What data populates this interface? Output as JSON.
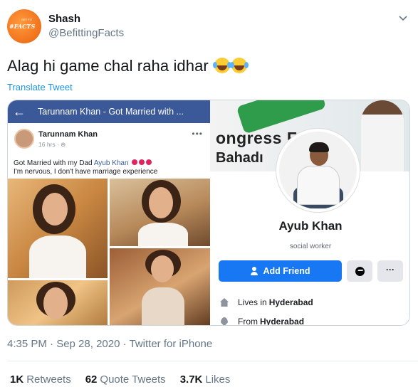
{
  "author": {
    "name": "Shash",
    "handle": "@BefittingFacts",
    "avatar_text": "#FACTS",
    "avatar_subtext": "GET FIT"
  },
  "tweet": {
    "text": "Alag hi game chal raha idhar",
    "emojis": [
      "face-with-tears-of-joy",
      "face-with-tears-of-joy"
    ],
    "translate_label": "Translate Tweet",
    "timestamp": "4:35 PM · Sep 28, 2020 · Twitter for iPhone"
  },
  "media_left": {
    "header_title": "Tarunnam Khan - Got Married with ...",
    "post_author": "Tarunnam Khan",
    "post_meta": "16 hrs · ⊕",
    "post_line1_prefix": "Got Married with my Dad ",
    "post_line1_link": "Ayub Khan",
    "post_line2": "I'm nervous, I don't have marriage experience"
  },
  "media_right": {
    "banner_line1": "ongress F",
    "banner_line2": "Bahadı",
    "profile_name": "Ayub Khan",
    "bio": "social worker",
    "add_friend_label": "Add Friend",
    "more_label": "···",
    "lives_in_label": "Lives in",
    "lives_in_value": "Hyderabad",
    "from_label": "From",
    "from_value": "Hyderabad"
  },
  "stats": {
    "retweets_count": "1K",
    "retweets_label": "Retweets",
    "quotes_count": "62",
    "quotes_label": "Quote Tweets",
    "likes_count": "3.7K",
    "likes_label": "Likes"
  },
  "colors": {
    "link_blue": "#1b95e0",
    "fb_blue": "#3b5998",
    "fb_button": "#1877f2",
    "avatar_orange": "#f0721c"
  }
}
